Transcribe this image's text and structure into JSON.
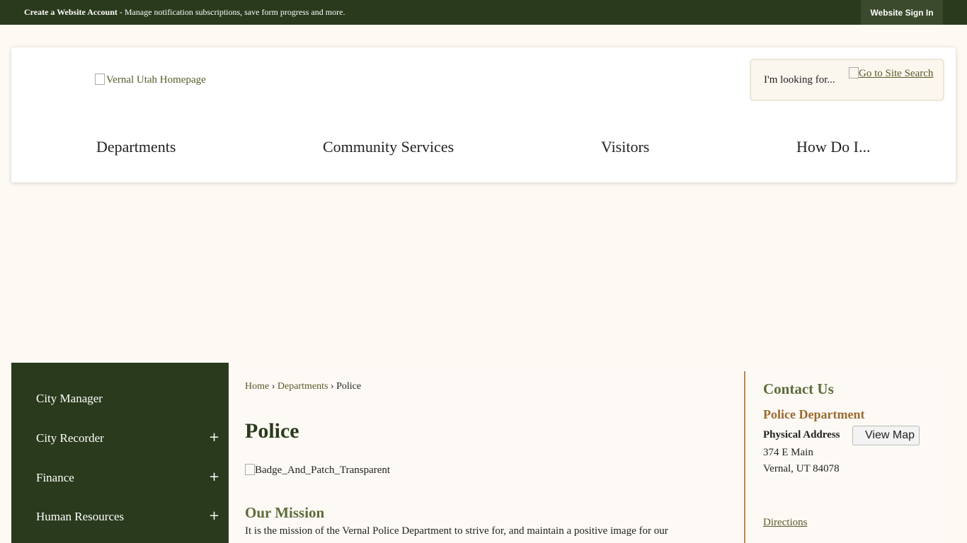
{
  "topbar": {
    "create_account": "Create a Website Account",
    "message": " - Manage notification subscriptions, save form progress and more.",
    "sign_in": "Website Sign In"
  },
  "header": {
    "logo_alt": "Vernal Utah Homepage",
    "search_placeholder": "I'm looking for...",
    "search_button_alt": "Go to Site Search",
    "nav": [
      "Departments",
      "Community Services",
      "Visitors",
      "How Do I..."
    ]
  },
  "sidebar": {
    "items": [
      {
        "label": "City Manager",
        "expandable": false
      },
      {
        "label": "City Recorder",
        "expandable": true
      },
      {
        "label": "Finance",
        "expandable": true
      },
      {
        "label": "Human Resources",
        "expandable": true
      }
    ],
    "expand_glyph": "+"
  },
  "breadcrumb": {
    "home": "Home",
    "departments": "Departments",
    "current": "Police",
    "separator": "›"
  },
  "main": {
    "title": "Police",
    "image_alt": "Badge_And_Patch_Transparent",
    "mission_heading": "Our Mission",
    "mission_text": "It is the mission of the Vernal Police Department to strive for, and maintain a positive image for our"
  },
  "contact": {
    "heading": "Contact Us",
    "department": "Police Department",
    "physical_address_label": "Physical Address",
    "view_map": "View Map",
    "address_line1": "374 E Main",
    "address_line2": "Vernal, UT 84078",
    "directions": "Directions"
  },
  "colors": {
    "topbar_bg": "#2a3a1c",
    "page_bg": "#fdf9f3",
    "accent_green": "#5d6b3a",
    "accent_brown": "#9b6a30"
  }
}
